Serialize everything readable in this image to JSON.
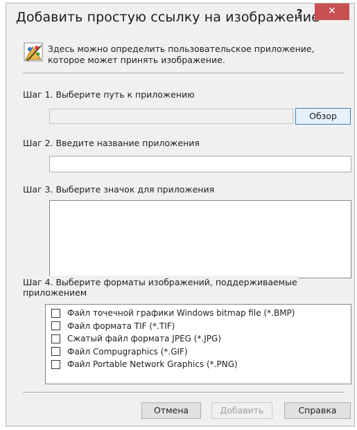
{
  "dialog": {
    "title": "Добавить простую ссылку на изображение",
    "help_label": "?",
    "close_label": "✕"
  },
  "intro": {
    "icon": "paint-palette-icon",
    "line1": "Здесь можно определить пользовательское приложение,",
    "line2": "которое может принять изображение."
  },
  "step1": {
    "label": "Шаг 1. Выберите путь к приложению",
    "path_value": "",
    "browse_label": "Обзор"
  },
  "step2": {
    "label": "Шаг 2. Введите название приложения",
    "name_value": ""
  },
  "step3": {
    "label": "Шаг 3. Выберите значок для приложения"
  },
  "step4": {
    "label_line1": "Шаг 4. Выберите форматы изображений, поддерживаемые",
    "label_line2": "приложением",
    "formats": [
      {
        "label": "Файл точечной графики Windows bitmap file (*.BMP)",
        "checked": false
      },
      {
        "label": "Файл формата TIF (*.TIF)",
        "checked": false
      },
      {
        "label": "Сжатый файл формата JPEG (*.JPG)",
        "checked": false
      },
      {
        "label": "Файл Compugraphics (*.GIF)",
        "checked": false
      },
      {
        "label": "Файл Portable Network Graphics (*.PNG)",
        "checked": false
      }
    ]
  },
  "buttons": {
    "cancel": "Отмена",
    "add": "Добавить",
    "help": "Справка"
  }
}
